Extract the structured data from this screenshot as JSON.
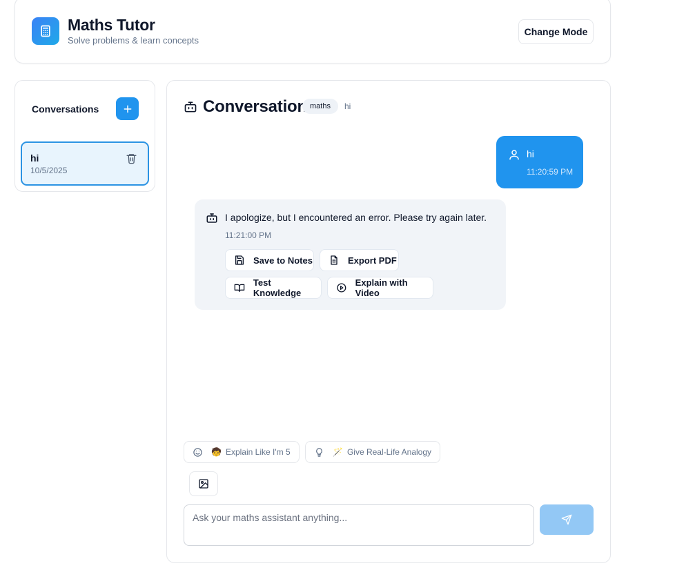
{
  "header": {
    "title": "Maths Tutor",
    "subtitle": "Solve problems & learn concepts",
    "change_mode_label": "Change Mode",
    "logo_icon": "calculator-icon"
  },
  "sidebar": {
    "title": "Conversations",
    "new_icon": "plus-icon",
    "conversations": [
      {
        "name": "hi",
        "date": "10/5/2025",
        "active": true
      }
    ]
  },
  "conversation": {
    "title": "Conversation",
    "tag": "maths",
    "subtitle": "hi",
    "messages": [
      {
        "role": "user",
        "text": "hi",
        "time": "11:20:59 PM"
      },
      {
        "role": "assistant",
        "text": "I apologize, but I encountered an error. Please try again later.",
        "time": "11:21:00 PM"
      }
    ],
    "actions": {
      "save": "Save to Notes",
      "export": "Export PDF",
      "test": "Test Knowledge",
      "video": "Explain with Video"
    }
  },
  "suggestions": [
    {
      "emoji": "🧒",
      "label": "Explain Like I'm 5"
    },
    {
      "emoji": "🪄",
      "label": "Give Real-Life Analogy"
    }
  ],
  "composer": {
    "placeholder": "Ask your maths assistant anything...",
    "value": ""
  },
  "colors": {
    "accent": "#2094ee",
    "send_disabled": "#93c8f5",
    "active_item_bg": "#e8f4fd",
    "bot_bubble_bg": "#f1f4f8"
  }
}
